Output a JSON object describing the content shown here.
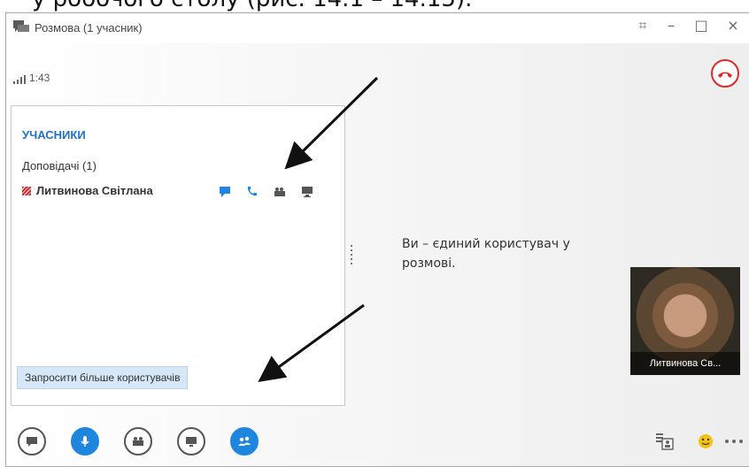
{
  "caption_fragment": "у робочого столу (рис. 14.1 – 14.15).",
  "window": {
    "title": "Розмова (1 учасник)",
    "controls": {
      "focus": "⌗",
      "minimize": "–",
      "maximize": "□",
      "close": "×"
    }
  },
  "call": {
    "duration": "1:43",
    "hangup_color": "#e0292b"
  },
  "participants_panel": {
    "title": "УЧАСНИКИ",
    "group_label": "Доповідачі (1)",
    "participant": {
      "name": "Литвинова Світлана",
      "status_color": "#d9262c",
      "icons": [
        "im-icon",
        "phone-icon",
        "video-icon",
        "screen-icon"
      ]
    },
    "invite_button_label": "Запросити більше користувачів"
  },
  "main_message": "Ви – єдиний користувач у розмові.",
  "self_video": {
    "label": "Литвинова Св..."
  },
  "toolbar": {
    "buttons": [
      "im-button",
      "mic-button",
      "video-button",
      "present-button",
      "participants-button"
    ],
    "right": [
      "tile-view-icon",
      "emoticon-icon",
      "more-icon"
    ]
  },
  "accent_color": "#1f86e0"
}
